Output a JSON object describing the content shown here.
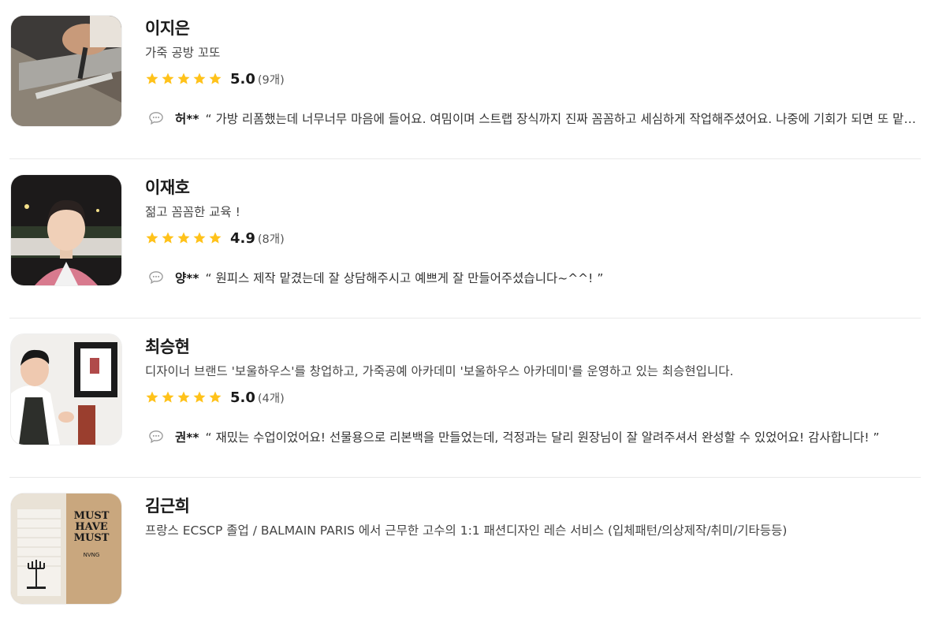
{
  "instructors": [
    {
      "name": "이지은",
      "description": "가죽 공방 꼬또",
      "rating": "5.0",
      "rating_value": 5.0,
      "review_count": "(9개)",
      "reviewer": "허**",
      "review": "“ 가방 리폼했는데 너무너무 마음에 들어요. 여밈이며 스트랩 장식까지 진짜 꼼꼼하고 세심하게 작업해주셨어요. 나중에 기회가 되면 또 맡기고 싶어요! ”"
    },
    {
      "name": "이재호",
      "description": "젊고 꼼꼼한 교육 !",
      "rating": "4.9",
      "rating_value": 4.9,
      "review_count": "(8개)",
      "reviewer": "양**",
      "review": "“ 원피스 제작 맡겼는데 잘 상담해주시고 예쁘게 잘 만들어주셨습니다~^^! ”"
    },
    {
      "name": "최승현",
      "description": "디자이너 브랜드 '보울하우스'를 창업하고, 가죽공예 아카데미 '보울하우스 아카데미'를 운영하고 있는 최승현입니다.",
      "rating": "5.0",
      "rating_value": 5.0,
      "review_count": "(4개)",
      "reviewer": "권**",
      "review": "“ 재밌는 수업이었어요! 선물용으로 리본백을 만들었는데, 걱정과는 달리 원장님이 잘 알려주셔서 완성할 수 있었어요! 감사합니다! ”"
    },
    {
      "name": "김근희",
      "description": "프랑스 ECSCP 졸업 / BALMAIN PARIS 에서 근무한 고수의 1:1 패션디자인 레슨 서비스 (입체패턴/의상제작/취미/기타등등)",
      "poster_text": "MUST HAVE MUST",
      "poster_sub": "NVNG"
    }
  ],
  "colors": {
    "star": "#FFC21A",
    "divider": "#E9E9E9",
    "chat_icon": "#9A9A9A"
  },
  "icons": [
    "star-icon",
    "chat-bubble-icon"
  ]
}
